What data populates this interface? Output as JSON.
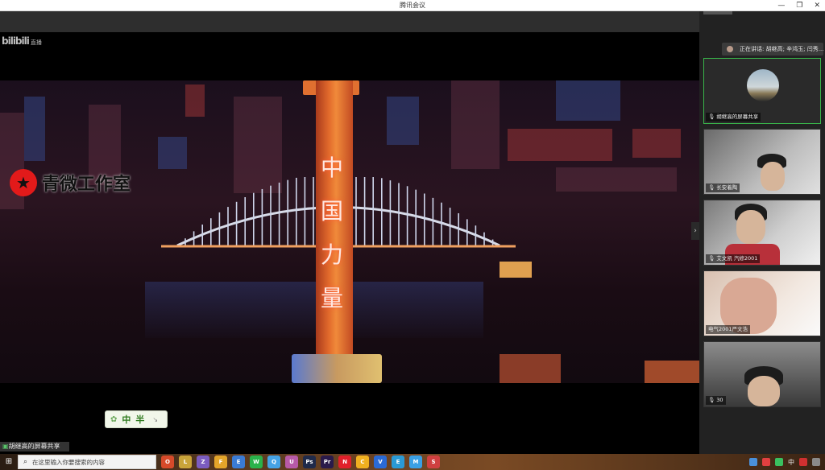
{
  "window": {
    "title": "腾讯会议",
    "controls": [
      "—",
      "❐",
      "✕"
    ]
  },
  "stream": {
    "platform_logo": "bilibili",
    "platform_suffix": "直播",
    "watermark": "青微工作室",
    "tower_text": [
      "中",
      "国",
      "力",
      "量"
    ]
  },
  "ime": {
    "mode1": "中",
    "mode2": "半",
    "icon": "gear-icon"
  },
  "share_label": "胡继高的屏幕共享",
  "speaking": "正在讲话: 胡继高; 辛鸿玉; 闫秀...",
  "participants": [
    {
      "name": "胡继高的屏幕共享",
      "active": true
    },
    {
      "name": "长安着陶",
      "active": false
    },
    {
      "name": "艾文凯 汽修2001",
      "active": false
    },
    {
      "name": "电气2001严文浩",
      "active": false
    },
    {
      "name": "30",
      "active": false
    }
  ],
  "taskbar": {
    "search_placeholder": "在这里输入你要搜索的内容",
    "apps": [
      "O",
      "L",
      "Z",
      "F",
      "E",
      "W",
      "Q",
      "U",
      "Ps",
      "Pr",
      "N",
      "C",
      "V",
      "E",
      "M",
      "S"
    ],
    "ime_indicator": "中",
    "app_colors": [
      "#d64a2a",
      "#c9a43a",
      "#7b5cc0",
      "#e3a52a",
      "#3a7bd5",
      "#2ab24a",
      "#45a3e5",
      "#b75aa8",
      "#1f2a4a",
      "#2a1a4a",
      "#e0202a",
      "#f0b020",
      "#2a6ad5",
      "#2a9ad5",
      "#3aa0e5",
      "#d04040"
    ]
  }
}
